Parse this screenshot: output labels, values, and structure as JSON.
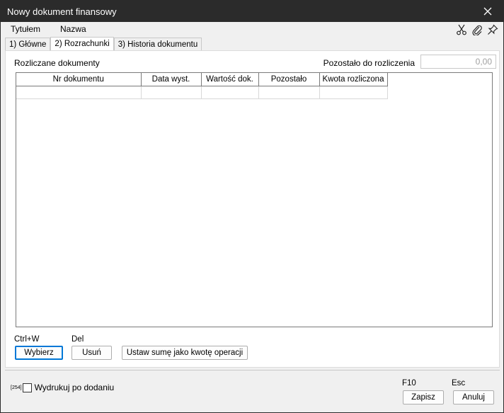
{
  "window": {
    "title": "Nowy dokument finansowy"
  },
  "header": {
    "label_tytulem": "Tytułem",
    "label_nazwa": "Nazwa"
  },
  "toolbar_icons": [
    "scissors-icon",
    "paperclip-icon",
    "pin-icon"
  ],
  "tabs": [
    {
      "label": "1) Główne",
      "active": false
    },
    {
      "label": "2) Rozrachunki",
      "active": true
    },
    {
      "label": "3) Historia dokumentu",
      "active": false
    }
  ],
  "rozrachunki": {
    "settled_label": "Rozliczane dokumenty",
    "remaining_label": "Pozostało do rozliczenia",
    "remaining_value": "0,00",
    "columns": [
      "Nr dokumentu",
      "Data wyst.",
      "Wartość dok.",
      "Pozostało",
      "Kwota rozliczona"
    ]
  },
  "actions": {
    "wybierz": {
      "hotkey": "Ctrl+W",
      "label": "Wybierz"
    },
    "usun": {
      "hotkey": "Del",
      "label": "Usuń"
    },
    "ustaw": {
      "label": "Ustaw sumę jako kwotę operacji"
    }
  },
  "footer": {
    "checkbox_prefix": "[254]",
    "checkbox_label": "Wydrukuj po dodaniu",
    "checked": false,
    "save": {
      "hotkey": "F10",
      "label": "Zapisz"
    },
    "cancel": {
      "hotkey": "Esc",
      "label": "Anuluj"
    }
  }
}
